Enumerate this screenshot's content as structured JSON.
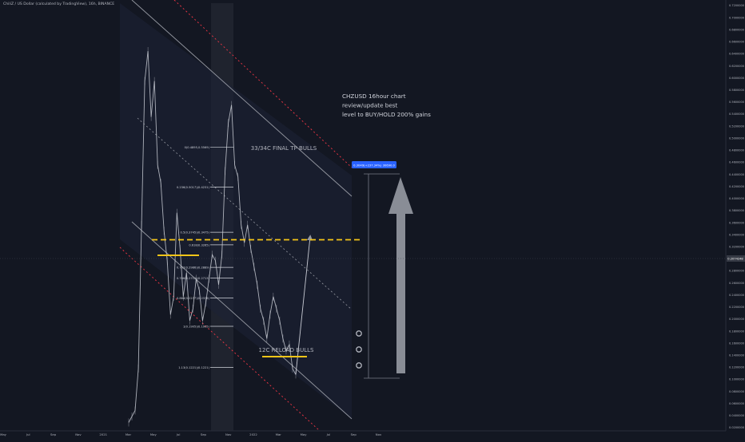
{
  "header": {
    "symbol_line": "ChiliZ / US Dollar (calculated by TradingView), 16h, BINANCE"
  },
  "colors": {
    "background": "#131722",
    "candle": "#c8cbd4",
    "channel": "#9598a1",
    "outer_channel": "#f23645",
    "target_line": "#f5c518",
    "support_line": "#f5c518",
    "fib_line": "#d1d4dc",
    "label_blue": "#2962ff",
    "arrow": "#9598a1"
  },
  "annotations": {
    "analysis_text": [
      "CHZUSD 16hour chart",
      "review/update best",
      "level to BUY/HOLD 200% gains"
    ],
    "final_tp": "33/34C FINAL TP BULLS",
    "reload": "12C RELOAD BULLS",
    "price_label": "0.3049(+237.34%) 30690.0"
  },
  "fib_levels": [
    {
      "label": "0(0.4895,0.5569)",
      "price": 0.4895
    },
    {
      "label": "0.236(0.5017)(0.4231)",
      "price": 0.4231
    },
    {
      "label": "0.5(0.3745)(0.3475)",
      "price": 0.3475
    },
    {
      "label": "0.618(0.3265)",
      "price": 0.3265
    },
    {
      "label": "0.702(0.2986)(0.2889)",
      "price": 0.2889
    },
    {
      "label": "0.786(0.2712)(0.2713)",
      "price": 0.2713
    },
    {
      "label": "0.886(0.2277)(0.2376)",
      "price": 0.2376
    },
    {
      "label": "1(0.1905)(0.1905)",
      "price": 0.1905
    },
    {
      "label": "1.13(0.1221)(0.1221)",
      "price": 0.1221
    }
  ],
  "axis": {
    "price_ticks": [
      "0.7200000",
      "0.7000000",
      "0.6800000",
      "0.6600000",
      "0.6400000",
      "0.6200000",
      "0.6000000",
      "0.5800000",
      "0.5600000",
      "0.5400000",
      "0.5200000",
      "0.5000000",
      "0.4800000",
      "0.4600000",
      "0.4400000",
      "0.4200000",
      "0.4000000",
      "0.3800000",
      "0.3600000",
      "0.3400000",
      "0.3200000",
      "0.3000000",
      "0.2800000",
      "0.2600000",
      "0.2400000",
      "0.2200000",
      "0.2000000",
      "0.1800000",
      "0.1600000",
      "0.1400000",
      "0.1200000",
      "0.1000000",
      "0.0800000",
      "0.0600000",
      "0.0400000",
      "0.0200000"
    ],
    "time_ticks": [
      "May",
      "Jul",
      "Sep",
      "Nov",
      "2021",
      "Mar",
      "May",
      "Jul",
      "Sep",
      "Nov",
      "2022",
      "Mar",
      "May",
      "Jul",
      "Sep",
      "Nov"
    ],
    "current_price": "0.2074248"
  },
  "chart_data": {
    "type": "line",
    "title": "ChiliZ / US Dollar (calculated by TradingView), 16h, BINANCE",
    "xlabel": "",
    "ylabel": "",
    "ylim": [
      0.02,
      0.73
    ],
    "x_ticks": [
      "May",
      "Jul",
      "Sep",
      "Nov",
      "2021",
      "Mar",
      "May",
      "Jul",
      "Sep",
      "Nov",
      "2022",
      "Mar",
      "May",
      "Jul",
      "Sep",
      "Nov"
    ],
    "series": [
      {
        "values": [
          0.03,
          0.04,
          0.05,
          0.12,
          0.36,
          0.6,
          0.65,
          0.54,
          0.6,
          0.46,
          0.43,
          0.35,
          0.3,
          0.21,
          0.24,
          0.38,
          0.32,
          0.24,
          0.28,
          0.2,
          0.22,
          0.27,
          0.25,
          0.2,
          0.23,
          0.27,
          0.31,
          0.3,
          0.26,
          0.31,
          0.45,
          0.53,
          0.56,
          0.46,
          0.44,
          0.36,
          0.33,
          0.36,
          0.32,
          0.29,
          0.26,
          0.22,
          0.2,
          0.17,
          0.21,
          0.24,
          0.22,
          0.2,
          0.17,
          0.15,
          0.16,
          0.12,
          0.11
        ]
      }
    ],
    "projection": [
      0.11,
      0.34
    ],
    "levels": {
      "final_tp": 0.335,
      "reload": 0.121
    }
  }
}
